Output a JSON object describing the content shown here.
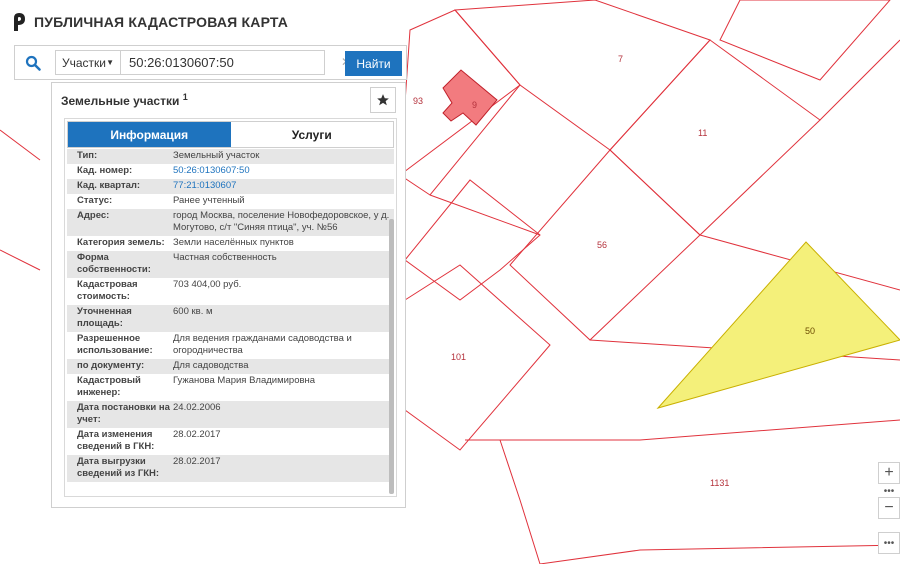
{
  "app": {
    "title": "ПУБЛИЧНАЯ КАДАСТРОВАЯ КАРТА"
  },
  "search": {
    "type_label": "Участки",
    "value": "50:26:0130607:50",
    "find_label": "Найти"
  },
  "panel": {
    "title": "Земельные участки",
    "title_count": "1",
    "tabs": [
      "Информация",
      "Услуги"
    ],
    "rows": [
      {
        "key": "Тип:",
        "value": "Земельный участок"
      },
      {
        "key": "Кад. номер:",
        "value": "50:26:0130607:50",
        "link": true
      },
      {
        "key": "Кад. квартал:",
        "value": "77:21:0130607",
        "link": true
      },
      {
        "key": "Статус:",
        "value": "Ранее учтенный"
      },
      {
        "key": "Адрес:",
        "value": "город Москва, поселение Новофедоровское, у д. Могутово, с/т \"Синяя птица\", уч. №56"
      },
      {
        "key": "Категория земель:",
        "value": "Земли населённых пунктов"
      },
      {
        "key": "Форма собственности:",
        "value": "Частная собственность"
      },
      {
        "key": "Кадастровая стоимость:",
        "value": "703 404,00 руб."
      },
      {
        "key": "Уточненная площадь:",
        "value": "600 кв. м"
      },
      {
        "key": "Разрешенное использование:",
        "value": "Для ведения гражданами садоводства и огородничества"
      },
      {
        "key": "по документу:",
        "value": "Для садоводства"
      },
      {
        "key": "Кадастровый инженер:",
        "value": "Гужанова Мария Владимировна"
      },
      {
        "key": "Дата постановки на учет:",
        "value": "24.02.2006"
      },
      {
        "key": "Дата изменения сведений в ГКН:",
        "value": "28.02.2017"
      },
      {
        "key": "Дата выгрузки сведений из ГКН:",
        "value": "28.02.2017"
      }
    ]
  },
  "map": {
    "parcel_labels": [
      "93",
      "9",
      "7",
      "11",
      "56",
      "50",
      "101",
      "1131"
    ],
    "colors": {
      "parcel_border": "#e0323c",
      "selected_fill": "#f4f07a",
      "highlight_fill": "#f27b7f"
    },
    "zoom_in": "+",
    "zoom_out": "−",
    "more": "•••"
  }
}
